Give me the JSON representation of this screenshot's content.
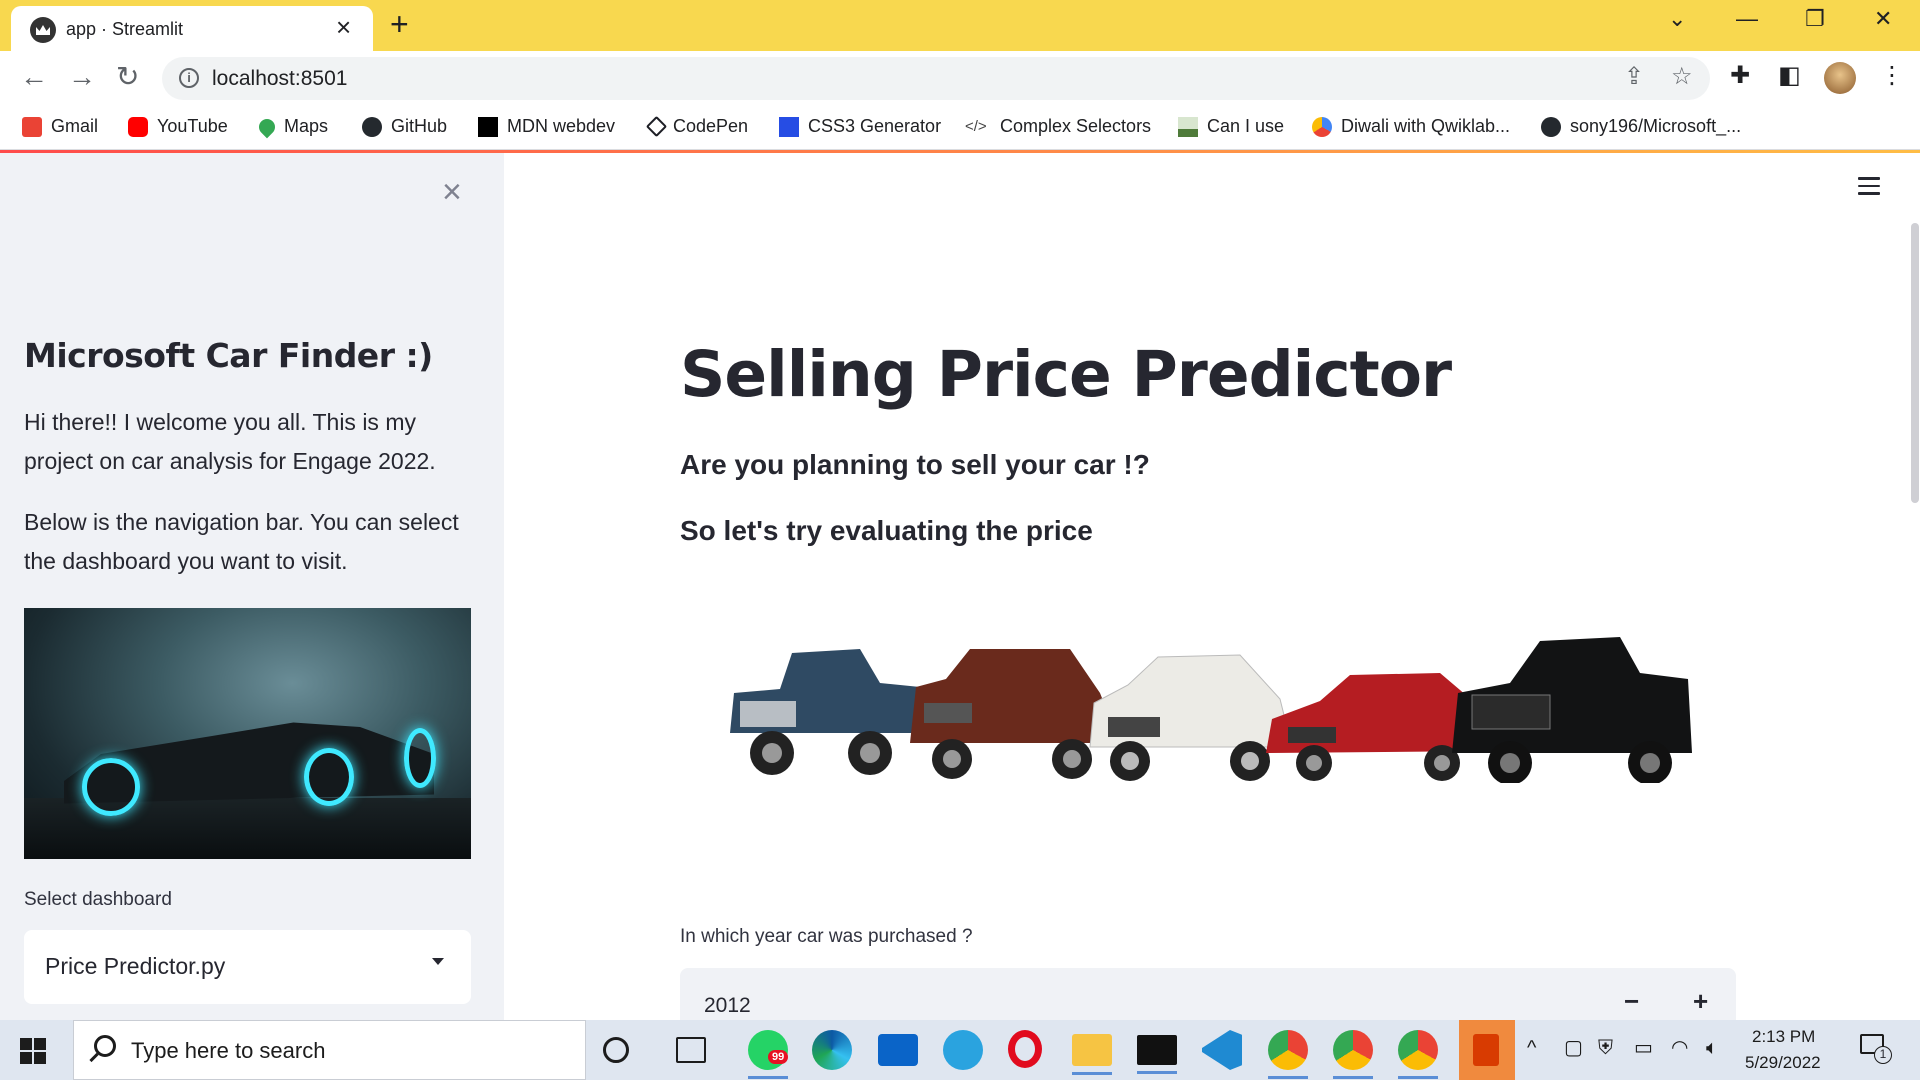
{
  "browser": {
    "tab_title": "app · Streamlit",
    "url": "localhost:8501",
    "bookmarks": [
      {
        "label": "Gmail",
        "icon": "gmail-icon",
        "color": "#ea4335"
      },
      {
        "label": "YouTube",
        "icon": "youtube-icon",
        "color": "#ff0000"
      },
      {
        "label": "Maps",
        "icon": "maps-icon",
        "color": "#34a853"
      },
      {
        "label": "GitHub",
        "icon": "github-icon",
        "color": "#24292e"
      },
      {
        "label": "MDN webdev",
        "icon": "mdn-icon",
        "color": "#000000"
      },
      {
        "label": "CodePen",
        "icon": "codepen-icon",
        "color": "#1e1f26"
      },
      {
        "label": "CSS3 Generator",
        "icon": "css3-icon",
        "color": "#264de4"
      },
      {
        "label": "Complex Selectors",
        "icon": "code-icon",
        "color": "#444444"
      },
      {
        "label": "Can I use",
        "icon": "caniuse-icon",
        "color": "#4f7b3a"
      },
      {
        "label": "Diwali with Qwiklab...",
        "icon": "google-cloud-icon",
        "color": "#4285f4"
      },
      {
        "label": "sony196/Microsoft_...",
        "icon": "github-icon",
        "color": "#24292e"
      }
    ]
  },
  "sidebar": {
    "title": "Microsoft Car Finder :)",
    "intro": "Hi there!! I welcome you all. This is my project on car analysis for Engage 2022.",
    "nav_hint": "Below is the navigation bar. You can select the dashboard you want to visit.",
    "select_label": "Select dashboard",
    "select_value": "Price Predictor.py"
  },
  "main": {
    "title": "Selling Price Predictor",
    "question": "Are you planning to sell your car !?",
    "prompt": "So let's try evaluating the price",
    "year_label": "In which year car was purchased ?",
    "year_value": "2012",
    "minus": "−",
    "plus": "+"
  },
  "taskbar": {
    "search_placeholder": "Type here to search",
    "whatsapp_badge": "99",
    "time": "2:13 PM",
    "date": "5/29/2022",
    "notification_count": "1"
  },
  "colors": {
    "tab_bar": "#f8d84f",
    "sidebar_bg": "#f0f2f6",
    "text": "#262730",
    "accent": "#ff4b4b"
  }
}
